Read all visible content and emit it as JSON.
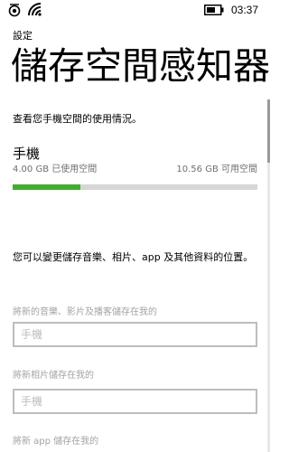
{
  "status_bar": {
    "time": "03:37",
    "signal_icon": "cellular-signal-icon",
    "wifi_icon": "wifi-icon",
    "battery_icon": "battery-icon"
  },
  "header": {
    "app_title": "設定",
    "page_title": "儲存空間感知器"
  },
  "description": "查看您手機空間的使用情況。",
  "storage": {
    "name": "手機",
    "used_label": "4.00 GB 已使用空間",
    "free_label": "10.56 GB 可用空間",
    "used_fraction": 0.275,
    "bar_fill_color": "#3fae29",
    "bar_track_color": "#d6d6d6"
  },
  "change_info": "您可以變更儲存音樂、相片、app 及其他資料的位置。",
  "locations": [
    {
      "label": "將新的音樂、影片及播客儲存在我的",
      "value": "手機"
    },
    {
      "label": "將新相片儲存在我的",
      "value": "手機"
    },
    {
      "label": "將新 app 儲存在我的",
      "value": ""
    }
  ]
}
